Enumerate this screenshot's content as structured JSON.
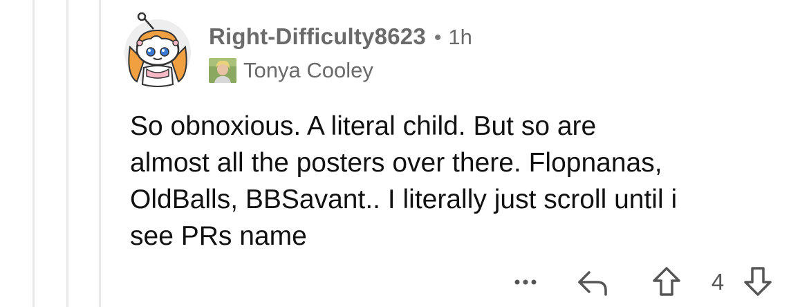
{
  "comment": {
    "username": "Right-Difficulty8623",
    "separator": "•",
    "time": "1h",
    "flair_text": "Tonya Cooley",
    "body_lines": [
      "So obnoxious. A literal child. But so are",
      "almost all the posters over there. Flopnanas,",
      "OldBalls, BBSavant.. I literally just scroll until i",
      "see PRs name"
    ]
  },
  "actions": {
    "more_glyph": "•••",
    "score": "4",
    "icons": [
      "more-icon",
      "reply-icon",
      "upvote-icon",
      "downvote-icon"
    ]
  },
  "colors": {
    "username": "#6a6a6a",
    "body": "#111111",
    "thread_line": "#e8e8e8",
    "icon": "#555555"
  }
}
